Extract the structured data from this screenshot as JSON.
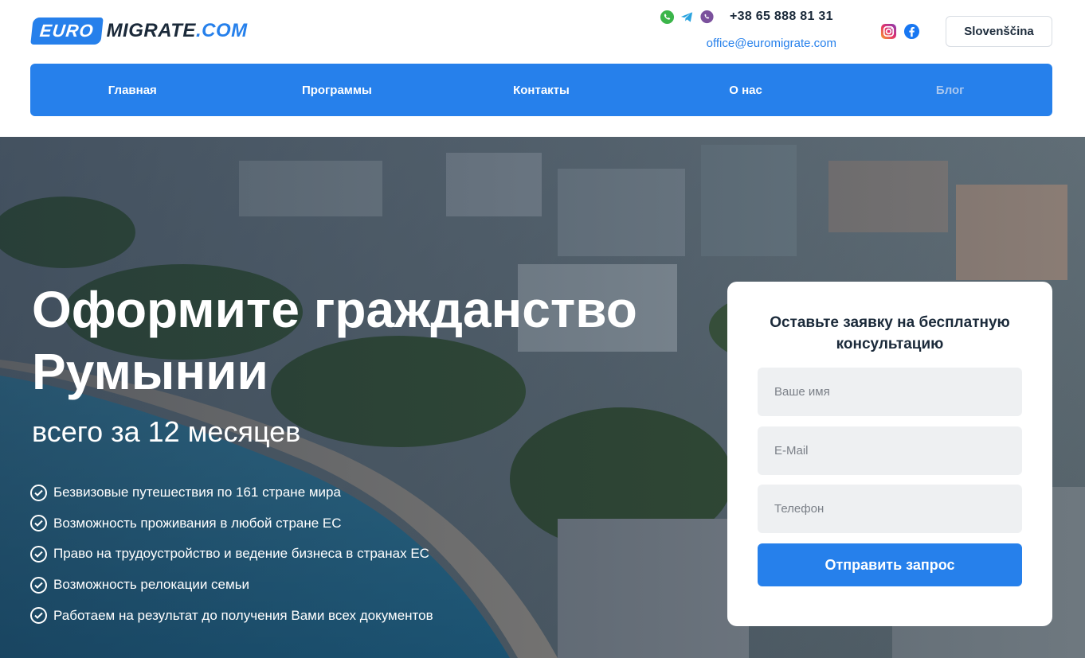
{
  "brand": {
    "logo_badge": "EURO",
    "logo_name": "MIGRATE",
    "logo_domain": ".COM",
    "accent": "#2680eb"
  },
  "header": {
    "messengers": [
      "whatsapp-icon",
      "telegram-icon",
      "viber-icon"
    ],
    "phone": "+38 65 888 81 31",
    "email": "office@euromigrate.com",
    "socials": [
      "instagram-icon",
      "facebook-icon"
    ],
    "language": "Slovenščina"
  },
  "nav": {
    "items": [
      {
        "label": "Главная"
      },
      {
        "label": "Программы"
      },
      {
        "label": "Контакты"
      },
      {
        "label": "О нас"
      },
      {
        "label": "Блог"
      }
    ]
  },
  "hero": {
    "title": "Оформите гражданство Румынии",
    "subtitle": "всего за 12 месяцев",
    "benefits": [
      "Безвизовые путешествия по 161 стране мира",
      "Возможность проживания в любой стране ЕС",
      "Право на трудоустройство и ведение бизнеса в странах ЕС",
      "Возможность релокации семьи",
      "Работаем на результат до получения Вами всех документов"
    ]
  },
  "form": {
    "title": "Оставьте заявку на бесплатную консультацию",
    "name_placeholder": "Ваше имя",
    "email_placeholder": "E-Mail",
    "phone_placeholder": "Телефон",
    "submit_label": "Отправить запрос"
  }
}
